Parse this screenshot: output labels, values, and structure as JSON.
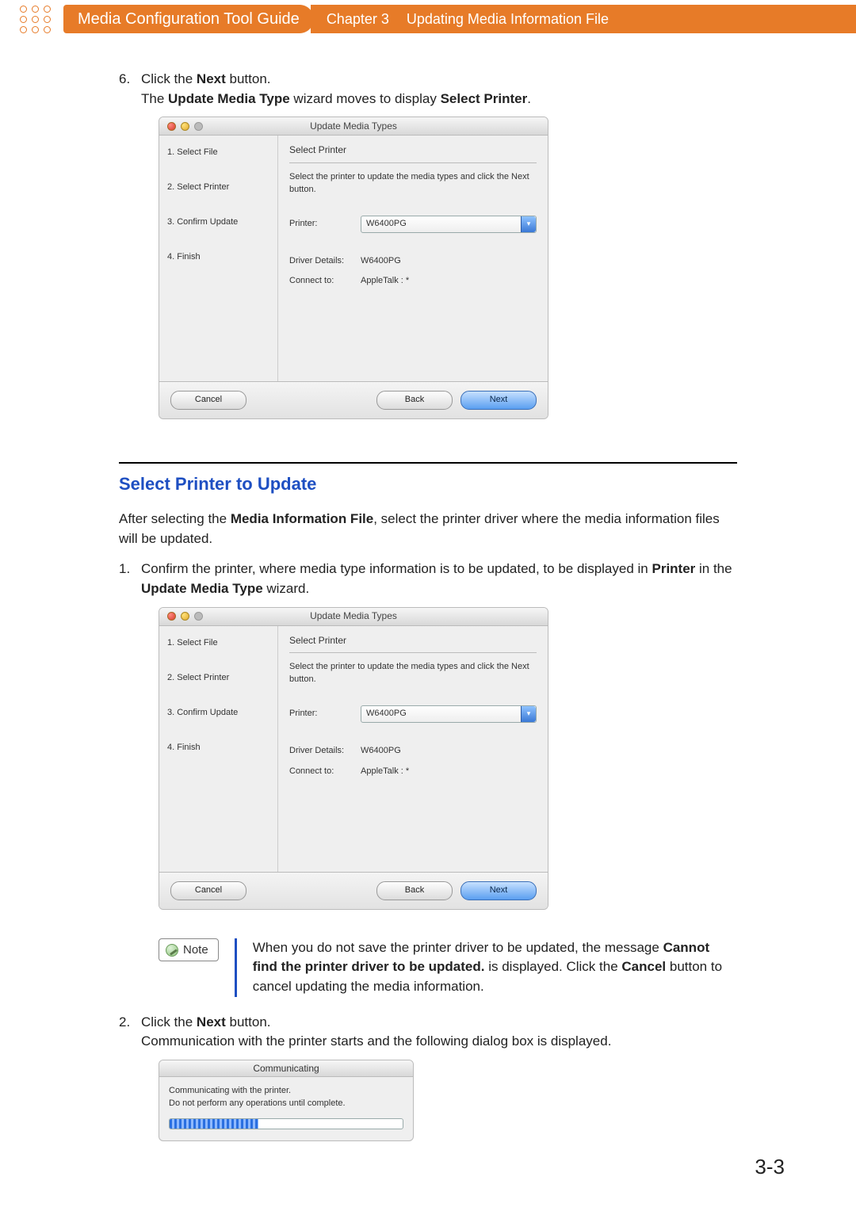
{
  "header": {
    "guide_title": "Media Configuration Tool Guide",
    "chapter": "Chapter 3",
    "chapter_title": "Updating Media Information File"
  },
  "step6": {
    "num": "6.",
    "line1_a": "Click the ",
    "line1_b": "Next",
    "line1_c": " button.",
    "line2_a": "The ",
    "line2_b": "Update Media Type",
    "line2_c": " wizard moves to display ",
    "line2_d": "Select Printer",
    "line2_e": "."
  },
  "mac": {
    "title": "Update Media Types",
    "side": [
      "1. Select File",
      "2. Select Printer",
      "3. Confirm Update",
      "4. Finish"
    ],
    "heading": "Select Printer",
    "instruction": "Select the printer to update the media types and click the Next button.",
    "printer_label": "Printer:",
    "printer_value": "W6400PG",
    "driver_label": "Driver Details:",
    "driver_value": "W6400PG",
    "connect_label": "Connect to:",
    "connect_value": "AppleTalk : *",
    "cancel": "Cancel",
    "back": "Back",
    "next": "Next"
  },
  "section_title": "Select Printer to Update",
  "intro_a": "After selecting the ",
  "intro_b": "Media Information File",
  "intro_c": ", select the printer driver where the media information files will be updated.",
  "step1": {
    "num": "1.",
    "a": "Confirm the printer, where media type information is to be updated, to be displayed in ",
    "b": "Printer",
    "c": " in the ",
    "d": "Update Media Type",
    "e": " wizard."
  },
  "note": {
    "label": "Note",
    "a": "When you do not save the printer driver to be updated, the message ",
    "b": "Cannot find the printer driver to be updated.",
    "c": " is displayed. Click the ",
    "d": "Cancel",
    "e": " button to cancel updating the media information."
  },
  "step2": {
    "num": "2.",
    "a": "Click the ",
    "b": "Next",
    "c": " button.",
    "d": "Communication with the printer starts and the following dialog box is displayed."
  },
  "comm": {
    "title": "Communicating",
    "l1": "Communicating with the printer.",
    "l2": "Do not perform any operations until complete."
  },
  "page_number": "3-3"
}
